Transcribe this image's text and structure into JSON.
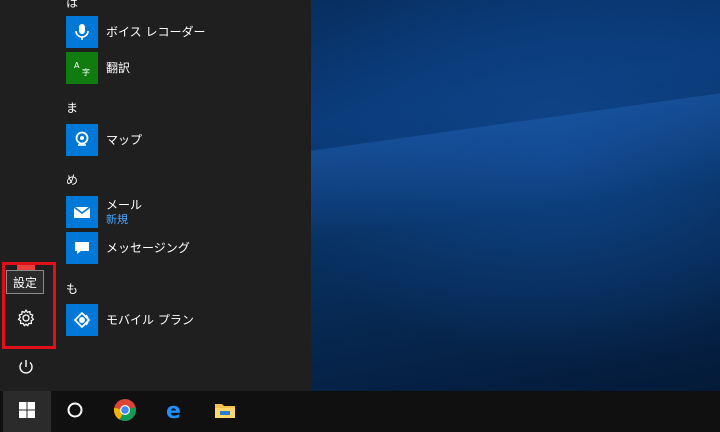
{
  "desktop": {
    "wallpaper": "windows-10-hero",
    "accent": "#0a3a78"
  },
  "start_menu": {
    "groups": [
      {
        "letter": "は",
        "apps": [
          {
            "name": "ボイス レコーダー",
            "icon": "microphone-icon",
            "tile_color": "#0078d7"
          },
          {
            "name": "翻訳",
            "icon": "translator-icon",
            "tile_color": "#107c10"
          }
        ]
      },
      {
        "letter": "ま",
        "apps": [
          {
            "name": "マップ",
            "icon": "map-pin-icon",
            "tile_color": "#0078d7"
          }
        ]
      },
      {
        "letter": "め",
        "apps": [
          {
            "name": "メール",
            "subtitle": "新規",
            "icon": "mail-icon",
            "tile_color": "#0078d7"
          },
          {
            "name": "メッセージング",
            "icon": "chat-icon",
            "tile_color": "#0078d7"
          }
        ]
      },
      {
        "letter": "も",
        "apps": [
          {
            "name": "モバイル プラン",
            "icon": "mobile-plans-icon",
            "tile_color": "#0078d7"
          }
        ]
      }
    ],
    "rail": {
      "settings_tooltip": "設定",
      "settings_icon": "gear-icon",
      "power_icon": "power-icon",
      "highlight_color": "#e0101a"
    }
  },
  "taskbar": {
    "items": [
      "start-button",
      "cortana",
      "chrome",
      "edge",
      "file-explorer"
    ]
  }
}
